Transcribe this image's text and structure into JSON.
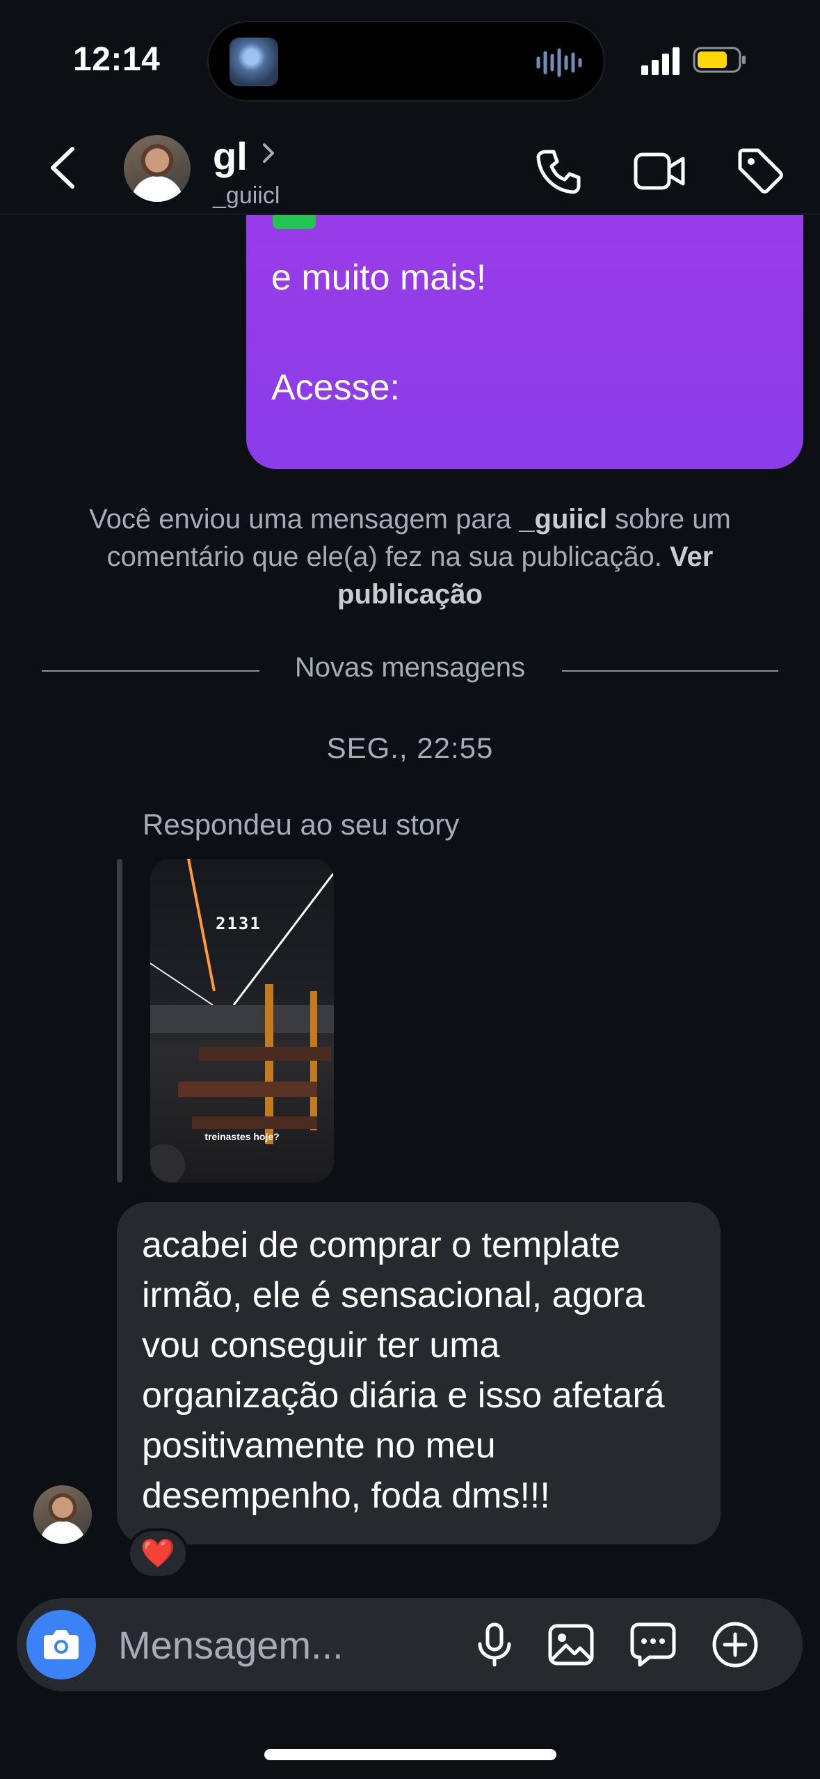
{
  "status_bar": {
    "time": "12:14"
  },
  "header": {
    "name": "gl",
    "username": "_guiicl"
  },
  "chat": {
    "sent_lines": [
      "e muito mais!",
      "Acesse:"
    ],
    "system_note": {
      "prefix": "Você enviou uma mensagem para ",
      "user": "_guiicl",
      "middle": " sobre um comentário que ele(a) fez na sua publicação. ",
      "link": "Ver publicação"
    },
    "divider_label": "Novas mensagens",
    "timestamp": "SEG., 22:55",
    "story_reply_label": "Respondeu ao seu story",
    "story": {
      "counter": "2131",
      "caption": "treinastes hoje?"
    },
    "received_message": "acabei de comprar o template irmão, ele é sensacional, agora vou conseguir ter uma organização diária e isso afetará positivamente no meu desempenho, foda dms!!!",
    "reaction": "❤️"
  },
  "composer": {
    "placeholder": "Mensagem..."
  },
  "colors": {
    "background": "#0c1014",
    "sent_bubble": "#9a3be8",
    "received_bubble": "#262a2f",
    "camera_button": "#3b82f6"
  }
}
